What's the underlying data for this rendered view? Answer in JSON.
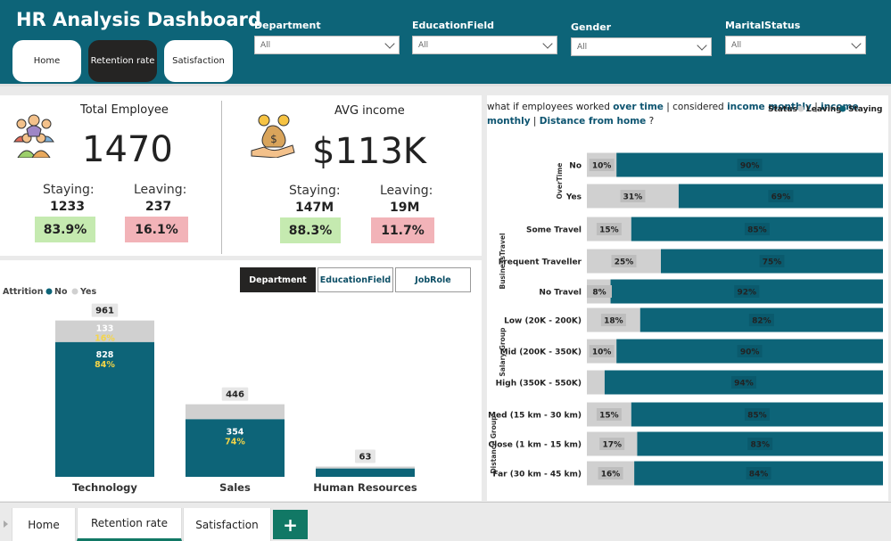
{
  "header": {
    "title": "HR Analysis Dashboard",
    "nav": [
      {
        "label": "Home"
      },
      {
        "label": "Retention rate"
      },
      {
        "label": "Satisfaction"
      }
    ],
    "filters": [
      {
        "label": "Department",
        "value": "All"
      },
      {
        "label": "EducationField",
        "value": "All"
      },
      {
        "label": "Gender",
        "value": "All"
      },
      {
        "label": "MaritalStatus",
        "value": "All"
      }
    ]
  },
  "kpi_employees": {
    "title": "Total Employee",
    "value": "1470",
    "staying_label": "Staying:",
    "staying_value": "1233",
    "staying_pct": "83.9%",
    "leaving_label": "Leaving:",
    "leaving_value": "237",
    "leaving_pct": "16.1%"
  },
  "kpi_income": {
    "title": "AVG income",
    "value": "$113K",
    "staying_label": "Staying:",
    "staying_value": "147M",
    "staying_pct": "88.3%",
    "leaving_label": "Leaving:",
    "leaving_value": "19M",
    "leaving_pct": "11.7%"
  },
  "attrition_tabs": [
    "Department",
    "EducationField",
    "JobRole"
  ],
  "colors": {
    "header": "#0d6478",
    "staying": "#0d6478",
    "leaving": "#d0d0d0",
    "green": "#c5eab0",
    "red": "#f2b3b8",
    "accent_text": "#f5d547"
  },
  "chart_data": [
    {
      "type": "bar",
      "stacked": true,
      "legend_title": "Attrition",
      "legend": [
        "No",
        "Yes"
      ],
      "categories": [
        "Technology",
        "Sales",
        "Human Resources"
      ],
      "totals": [
        961,
        446,
        63
      ],
      "series": [
        {
          "name": "No",
          "values": [
            828,
            354,
            51
          ],
          "labels": [
            "828",
            "354",
            ""
          ],
          "pct_labels": [
            "84%",
            "74%",
            ""
          ]
        },
        {
          "name": "Yes",
          "values": [
            133,
            92,
            12
          ],
          "labels": [
            "133",
            "",
            ""
          ],
          "pct_labels": [
            "16%",
            "",
            ""
          ]
        }
      ],
      "total_labels": [
        "961",
        "446",
        "63"
      ]
    },
    {
      "type": "bar",
      "orientation": "horizontal",
      "stacked_percent": true,
      "title_parts": [
        {
          "text": "what if employees worked ",
          "bold": false
        },
        {
          "text": "over time",
          "bold": true
        },
        {
          "text": " | considered ",
          "bold": false
        },
        {
          "text": "income monthly",
          "bold": true
        },
        {
          "text": " | ",
          "bold": false
        },
        {
          "text": "Business travel",
          "bold": true
        },
        {
          "text": " | ",
          "bold": false
        },
        {
          "text": "Distance from home",
          "bold": true
        },
        {
          "text": " ?",
          "bold": false
        }
      ],
      "legend_title": "Status",
      "legend": [
        "Leaving",
        "Staying"
      ],
      "groups": [
        {
          "name": "OverTime",
          "rows": [
            {
              "label": "No",
              "leaving": 10,
              "staying": 90
            },
            {
              "label": "Yes",
              "leaving": 31,
              "staying": 69
            }
          ]
        },
        {
          "name": "BusinessTravel",
          "rows": [
            {
              "label": "Some Travel",
              "leaving": 15,
              "staying": 85
            },
            {
              "label": "Frequent Traveller",
              "leaving": 25,
              "staying": 75
            },
            {
              "label": "No Travel",
              "leaving": 8,
              "staying": 92
            }
          ]
        },
        {
          "name": "Salary Group",
          "rows": [
            {
              "label": "Low (20K - 200K)",
              "leaving": 18,
              "staying": 82
            },
            {
              "label": "Mid (200K - 350K)",
              "leaving": 10,
              "staying": 90
            },
            {
              "label": "High (350K - 550K)",
              "leaving": 6,
              "staying": 94,
              "hide_leaving_label": true
            }
          ]
        },
        {
          "name": "Distance Group",
          "rows": [
            {
              "label": "Med (15 km - 30 km)",
              "leaving": 15,
              "staying": 85
            },
            {
              "label": "Close (1 km - 15 km)",
              "leaving": 17,
              "staying": 83
            },
            {
              "label": "Far (30 km - 45 km)",
              "leaving": 16,
              "staying": 84
            }
          ]
        }
      ]
    }
  ],
  "page_tabs": [
    {
      "label": "Home"
    },
    {
      "label": "Retention rate"
    },
    {
      "label": "Satisfaction"
    }
  ],
  "add_label": "+"
}
